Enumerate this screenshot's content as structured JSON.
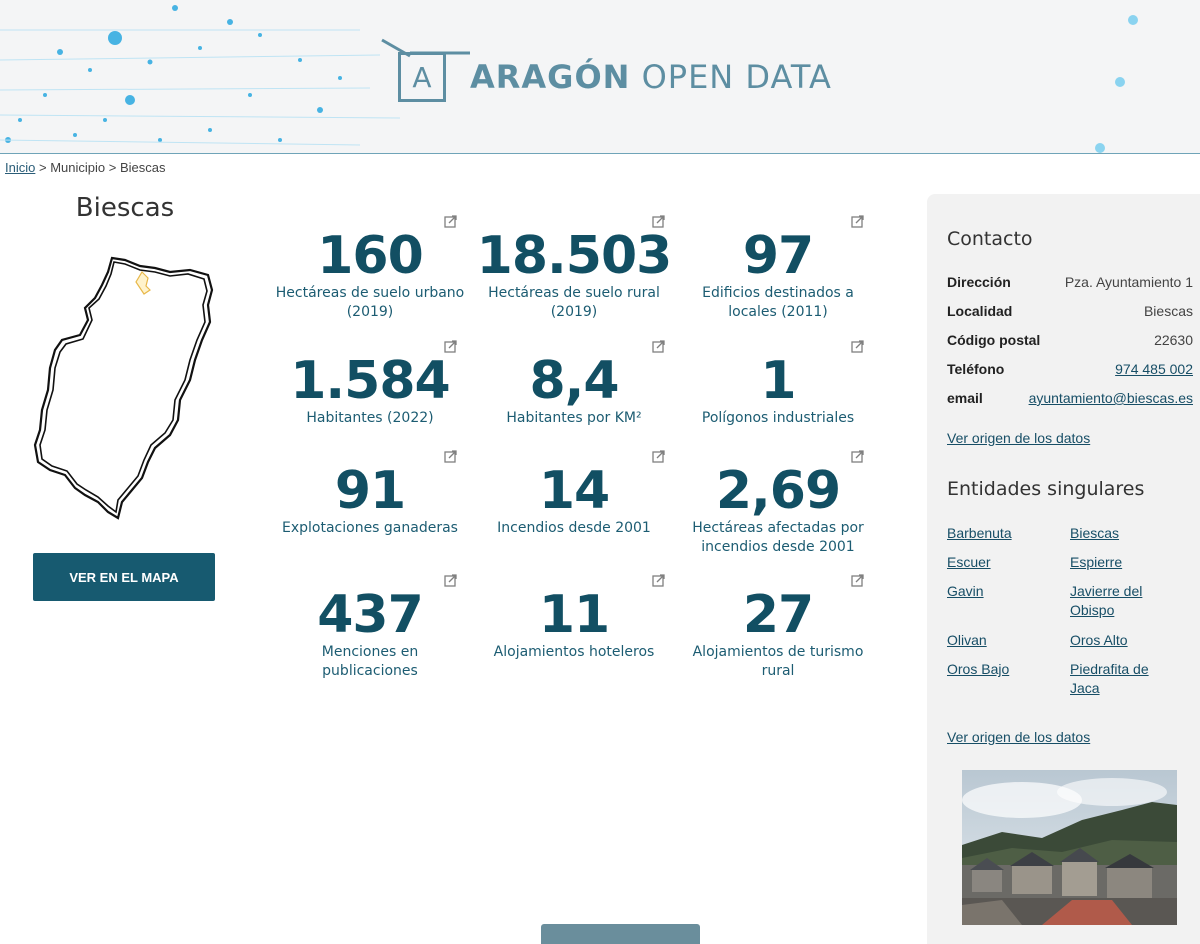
{
  "header": {
    "logo_letter": "A",
    "logo_bold": "ARAGÓN",
    "logo_light": "OPEN DATA"
  },
  "breadcrumb": {
    "home": "Inicio",
    "sep1": " > ",
    "section": "Municipio",
    "sep2": " > ",
    "current": "Biescas"
  },
  "municipality": {
    "name": "Biescas",
    "map_button": "VER EN EL MAPA"
  },
  "stats": [
    {
      "value": "160",
      "label_1": "Hectáreas de suelo urbano",
      "label_2": "(2019)"
    },
    {
      "value": "18.503",
      "label_1": "Hectáreas de suelo rural",
      "label_2": "(2019)"
    },
    {
      "value": "97",
      "label_1": "Edificios destinados a",
      "label_2": "locales (2011)"
    },
    {
      "value": "1.584",
      "label_1": "Habitantes (2022)",
      "label_2": ""
    },
    {
      "value": "8,4",
      "label_1": "Habitantes por KM²",
      "label_2": ""
    },
    {
      "value": "1",
      "label_1": "Polígonos industriales",
      "label_2": ""
    },
    {
      "value": "91",
      "label_1": "Explotaciones ganaderas",
      "label_2": ""
    },
    {
      "value": "14",
      "label_1": "Incendios desde 2001",
      "label_2": ""
    },
    {
      "value": "2,69",
      "label_1": "Hectáreas afectadas por",
      "label_2": "incendios desde 2001"
    },
    {
      "value": "437",
      "label_1": "Menciones en",
      "label_2": "publicaciones"
    },
    {
      "value": "11",
      "label_1": "Alojamientos hoteleros",
      "label_2": ""
    },
    {
      "value": "27",
      "label_1": "Alojamientos de turismo",
      "label_2": "rural"
    }
  ],
  "contact": {
    "title": "Contacto",
    "rows": [
      {
        "key": "Dirección",
        "value": "Pza. Ayuntamiento 1"
      },
      {
        "key": "Localidad",
        "value": "Biescas"
      },
      {
        "key": "Código postal",
        "value": "22630"
      },
      {
        "key": "Teléfono",
        "value": "974 485 002"
      },
      {
        "key": "email",
        "value": "ayuntamiento@biescas.es"
      }
    ],
    "origin_link": "Ver origen de los datos"
  },
  "entities": {
    "title": "Entidades singulares",
    "items": [
      {
        "l1": "Barbenuta",
        "l2": ""
      },
      {
        "l1": "Biescas",
        "l2": ""
      },
      {
        "l1": "Escuer",
        "l2": ""
      },
      {
        "l1": "Espierre",
        "l2": ""
      },
      {
        "l1": "Gavin",
        "l2": ""
      },
      {
        "l1": "Javierre del",
        "l2": "Obispo"
      },
      {
        "l1": "Olivan",
        "l2": ""
      },
      {
        "l1": "Oros Alto",
        "l2": ""
      },
      {
        "l1": "Oros Bajo",
        "l2": ""
      },
      {
        "l1": "Piedrafita de",
        "l2": "Jaca"
      }
    ],
    "origin_link": "Ver origen de los datos"
  },
  "colors": {
    "accent": "#124f63",
    "button": "#175a70",
    "logo": "#5d8ea2",
    "sidebar_bg": "#f2f2f2"
  }
}
